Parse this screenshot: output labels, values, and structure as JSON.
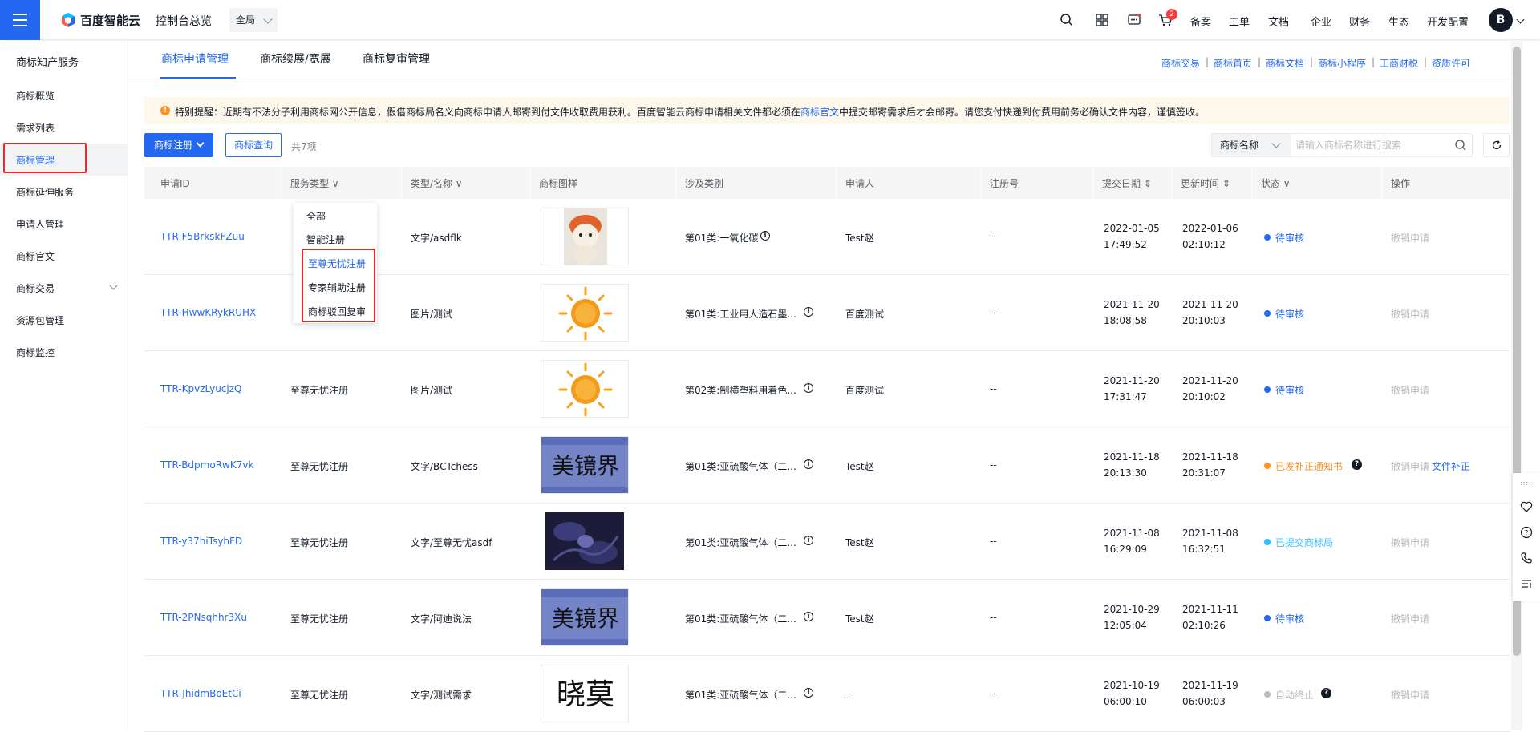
{
  "topbar": {
    "brand": "百度智能云",
    "console_title": "控制台总览",
    "region": "全局",
    "cart_badge": "2",
    "nav": [
      "备案",
      "工单",
      "文档",
      "企业",
      "财务",
      "生态",
      "开发配置"
    ],
    "avatar": "B"
  },
  "sidebar": {
    "title": "商标知产服务",
    "items": [
      "商标概览",
      "需求列表",
      "商标管理",
      "商标延伸服务",
      "申请人管理",
      "商标官文",
      "商标交易",
      "资源包管理",
      "商标监控"
    ],
    "active": "商标管理"
  },
  "tabs": [
    "商标申请管理",
    "商标续展/宽展",
    "商标复审管理"
  ],
  "quick_links": [
    "商标交易",
    "商标首页",
    "商标文档",
    "商标小程序",
    "工商财税",
    "资质许可"
  ],
  "notice": {
    "before": "特别提醒：近期有不法分子利用商标网公开信息，假借商标局名义向商标申请人邮寄到付文件收取费用获利。百度智能云商标申请相关文件都必须在",
    "link": "商标官文",
    "after": "中提交邮寄需求后才会邮寄。请您支付快递到付费用前务必确认文件内容，谨慎签收。"
  },
  "toolbar": {
    "register_btn": "商标注册",
    "query_btn": "商标查询",
    "total": "共7项",
    "search_select": "商标名称",
    "search_placeholder": "请输入商标名称进行搜索"
  },
  "table": {
    "headers": [
      "申请ID",
      "服务类型",
      "类型/名称",
      "商标图样",
      "涉及类别",
      "申请人",
      "注册号",
      "提交日期",
      "更新时间",
      "状态",
      "操作"
    ],
    "rows": [
      {
        "id": "TTR-F5BrkskFZuu",
        "service": "",
        "type_name": "文字/asdflk",
        "category": "第01类:一氧化碳",
        "applicant": "Test赵",
        "reg_no": "--",
        "submit_date": "2022-01-05",
        "submit_time": "17:49:52",
        "update_date": "2022-01-06",
        "update_time": "02:10:12",
        "status": "待审核",
        "ops": [
          "撤销申请"
        ]
      },
      {
        "id": "TTR-HwwKRykRUHX",
        "service": "",
        "type_name": "图片/测试",
        "category": "第01类:工业用人造石墨...",
        "applicant": "百度测试",
        "reg_no": "--",
        "submit_date": "2021-11-20",
        "submit_time": "18:08:58",
        "update_date": "2021-11-20",
        "update_time": "20:10:03",
        "status": "待审核",
        "ops": [
          "撤销申请"
        ]
      },
      {
        "id": "TTR-KpvzLyucjzQ",
        "service": "至尊无忧注册",
        "type_name": "图片/测试",
        "category": "第02类:制横塑料用着色...",
        "applicant": "百度测试",
        "reg_no": "--",
        "submit_date": "2021-11-20",
        "submit_time": "17:31:47",
        "update_date": "2021-11-20",
        "update_time": "20:10:02",
        "status": "待审核",
        "ops": [
          "撤销申请"
        ]
      },
      {
        "id": "TTR-BdpmoRwK7vk",
        "service": "至尊无忧注册",
        "type_name": "文字/BCTchess",
        "category": "第01类:亚硫酸气体（二...",
        "applicant": "Test赵",
        "reg_no": "--",
        "submit_date": "2021-11-18",
        "submit_time": "20:13:30",
        "update_date": "2021-11-18",
        "update_time": "20:31:07",
        "status": "已发补正通知书",
        "ops": [
          "撤销申请",
          "文件补正"
        ]
      },
      {
        "id": "TTR-y37hiTsyhFD",
        "service": "至尊无忧注册",
        "type_name": "文字/至尊无忧asdf",
        "category": "第01类:亚硫酸气体（二...",
        "applicant": "Test赵",
        "reg_no": "--",
        "submit_date": "2021-11-08",
        "submit_time": "16:29:09",
        "update_date": "2021-11-08",
        "update_time": "16:32:51",
        "status": "已提交商标局",
        "ops": [
          "撤销申请"
        ]
      },
      {
        "id": "TTR-2PNsqhhr3Xu",
        "service": "至尊无忧注册",
        "type_name": "文字/阿迪说法",
        "category": "第01类:亚硫酸气体（二...",
        "applicant": "Test赵",
        "reg_no": "--",
        "submit_date": "2021-10-29",
        "submit_time": "12:05:04",
        "update_date": "2021-11-11",
        "update_time": "02:10:26",
        "status": "待审核",
        "ops": [
          "撤销申请"
        ]
      },
      {
        "id": "TTR-JhidmBoEtCi",
        "service": "至尊无忧注册",
        "type_name": "文字/测试需求",
        "category": "第01类:亚硫酸气体（二...",
        "applicant": "--",
        "reg_no": "--",
        "submit_date": "2021-10-19",
        "submit_time": "06:00:10",
        "update_date": "2021-11-19",
        "update_time": "06:00:03",
        "status": "自动终止",
        "ops": [
          "撤销申请"
        ]
      }
    ]
  },
  "images": {
    "mirror_text": "美镜界",
    "xiaomo_text": "晓莫"
  },
  "dropdown": {
    "items": [
      "全部",
      "智能注册",
      "至尊无忧注册",
      "专家辅助注册",
      "商标驳回复审"
    ],
    "highlighted": "至尊无忧注册"
  },
  "colors": {
    "primary": "#2468f2",
    "pending": "#2468f2",
    "warning": "#ff9326",
    "submitted": "#30bfff",
    "terminated": "#b8babf",
    "highlight_box": "#e32c2c"
  }
}
